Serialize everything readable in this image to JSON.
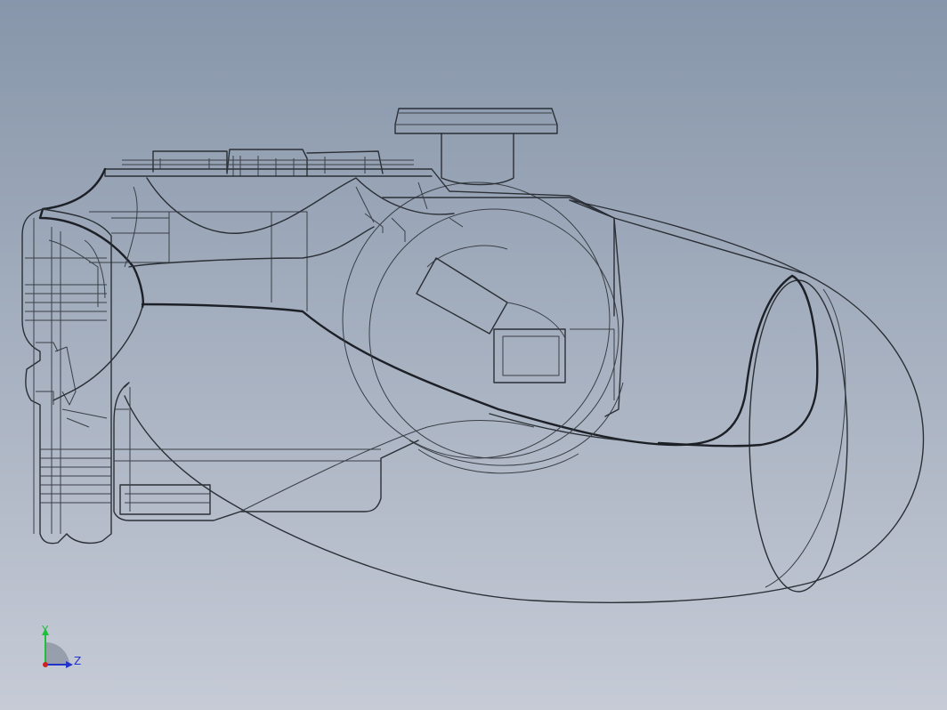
{
  "viewport": {
    "background_top": "#8796aa",
    "background_bottom": "#c6cbd6",
    "edge_color": "#2b2f36"
  },
  "triad": {
    "y_label": "Y",
    "z_label": "Z",
    "y_color": "#1fbf3a",
    "z_color": "#2233cc",
    "origin_color": "#cc2222"
  }
}
